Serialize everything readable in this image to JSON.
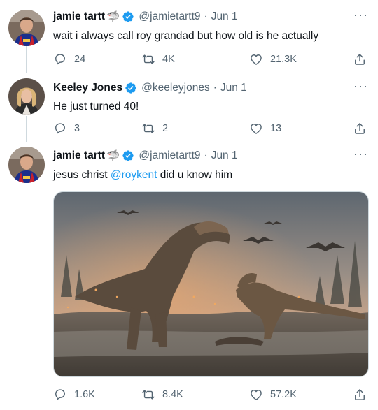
{
  "tweets": [
    {
      "name": "jamie tartt",
      "emoji": "🦈",
      "handle": "@jamietartt9",
      "dot": "·",
      "date": "Jun 1",
      "text": "wait i always call roy grandad but how old is he actually",
      "replies": "24",
      "retweets": "4K",
      "likes": "21.3K"
    },
    {
      "name": "Keeley Jones",
      "handle": "@keeleyjones",
      "dot": "·",
      "date": "Jun 1",
      "text": "He just turned 40!",
      "replies": "3",
      "retweets": "2",
      "likes": "13"
    },
    {
      "name": "jamie tartt",
      "emoji": "🦈",
      "handle": "@jamietartt9",
      "dot": "·",
      "date": "Jun 1",
      "text_before": "jesus christ",
      "mention": "@roykent",
      "text_after": "did u know him",
      "replies": "1.6K",
      "retweets": "8.4K",
      "likes": "57.2K"
    }
  ],
  "more_label": "···",
  "colors": {
    "accent": "#1d9bf0",
    "muted": "#536471",
    "thread_line": "#cfd9de"
  },
  "icons": [
    "verified-badge-icon",
    "reply-icon",
    "retweet-icon",
    "like-icon",
    "share-icon",
    "more-icon"
  ]
}
